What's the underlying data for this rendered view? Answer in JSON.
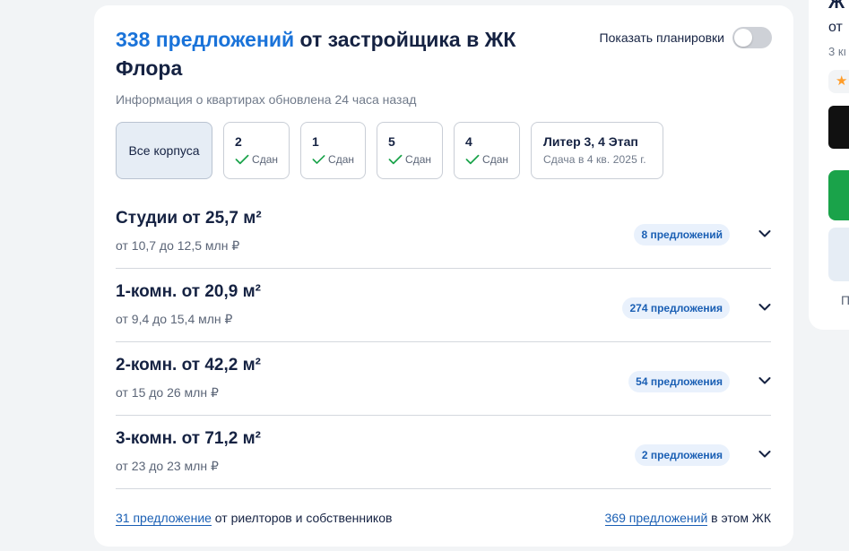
{
  "header": {
    "count_link": "338 предложений",
    "title_rest": " от застройщика в ЖК Флора",
    "toggle_label": "Показать планировки",
    "updated": "Информация о квартирах обновлена 24 часа назад"
  },
  "filters": {
    "all": "Все корпуса",
    "buildings": [
      {
        "num": "2",
        "status": "Сдан"
      },
      {
        "num": "1",
        "status": "Сдан"
      },
      {
        "num": "5",
        "status": "Сдан"
      },
      {
        "num": "4",
        "status": "Сдан"
      }
    ],
    "liter": {
      "title": "Литер 3, 4 Этап",
      "sub": "Сдача в 4 кв. 2025 г."
    }
  },
  "rows": [
    {
      "title": "Студии от 25,7 м²",
      "price": "от 10,7 до 12,5 млн ₽",
      "badge": "8 предложений"
    },
    {
      "title": "1-комн. от 20,9 м²",
      "price": "от 9,4 до 15,4 млн ₽",
      "badge": "274 предложения"
    },
    {
      "title": "2-комн. от 42,2 м²",
      "price": "от 15 до 26 млн ₽",
      "badge": "54 предложения"
    },
    {
      "title": "3-комн. от 71,2 м²",
      "price": "от 23 до 23 млн ₽",
      "badge": "2 предложения"
    }
  ],
  "footer": {
    "left_link": "31 предложение",
    "left_rest": " от риелторов и собственников",
    "right_link": "369 предложений",
    "right_rest": " в этом ЖК"
  },
  "side": {
    "line1": "Ж",
    "line2": "от",
    "line3": "3 кı",
    "star": "★",
    "p": "П"
  },
  "colors": {
    "accent": "#1a73d9",
    "check": "#1aa34a",
    "link": "#1a5fb4"
  }
}
